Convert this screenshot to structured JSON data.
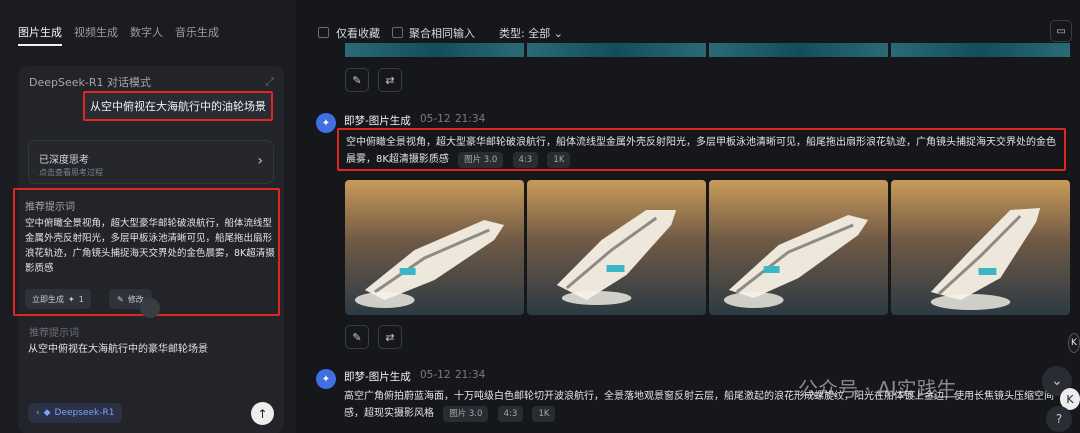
{
  "left": {
    "tabs": [
      "图片生成",
      "视频生成",
      "数字人",
      "音乐生成"
    ],
    "card_title": "DeepSeek-R1 对话模式",
    "user_message": "从空中俯视在大海航行中的油轮场景",
    "think": {
      "title": "已深度思考",
      "subtitle": "点击查看思考过程"
    },
    "prompt_title": "推荐提示词",
    "prompt_text": "空中俯瞰全景视角，超大型豪华邮轮破浪航行，船体流线型金属外壳反射阳光，多层甲板泳池清晰可见，船尾拖出扇形浪花轨迹，广角镜头捕捉海天交界处的金色晨雾，8K超清摄影质感",
    "generate_label": "立即生成",
    "generate_count": "1",
    "edit_label": "修改",
    "partial_label": "推荐提示词",
    "input_text": "从空中俯视在大海航行中的豪华邮轮场景",
    "model_label": "Deepseek-R1"
  },
  "topbar": {
    "fav_label": "仅看收藏",
    "merge_label": "聚合相同输入",
    "type_label": "类型: 全部"
  },
  "results": [
    {
      "name": "即梦-图片生成",
      "date": "05-12",
      "time": "21:34",
      "prompt": "空中俯瞰全景视角，超大型豪华邮轮破浪航行，船体流线型金属外壳反射阳光，多层甲板泳池清晰可见，船尾拖出扇形浪花轨迹，广角镜头捕捉海天交界处的金色晨雾，8K超清摄影质感",
      "tags": [
        "图片 3.0",
        "4:3",
        "1K"
      ],
      "image_count": 4
    },
    {
      "name": "即梦-图片生成",
      "date": "05-12",
      "time": "21:34",
      "prompt": "高空广角俯拍蔚蓝海面，十万吨级白色邮轮切开波浪航行，全景落地观景窗反射云层，船尾激起的浪花形成螺旋纹，阳光在船体镀上金边，使用长焦镜头压缩空间感，超现实摄影风格",
      "tags": [
        "图片 3.0",
        "4:3",
        "1K"
      ]
    }
  ],
  "watermark": "公众号 · AI实践生",
  "icons": {
    "expand": "expand-icon",
    "arrow": "chevron-right-icon",
    "spark": "spark-icon",
    "edit": "pencil-icon",
    "remix": "remix-icon",
    "send": "arrow-up-icon",
    "folder": "folder-icon",
    "chevron_down": "chevron-down-icon"
  }
}
